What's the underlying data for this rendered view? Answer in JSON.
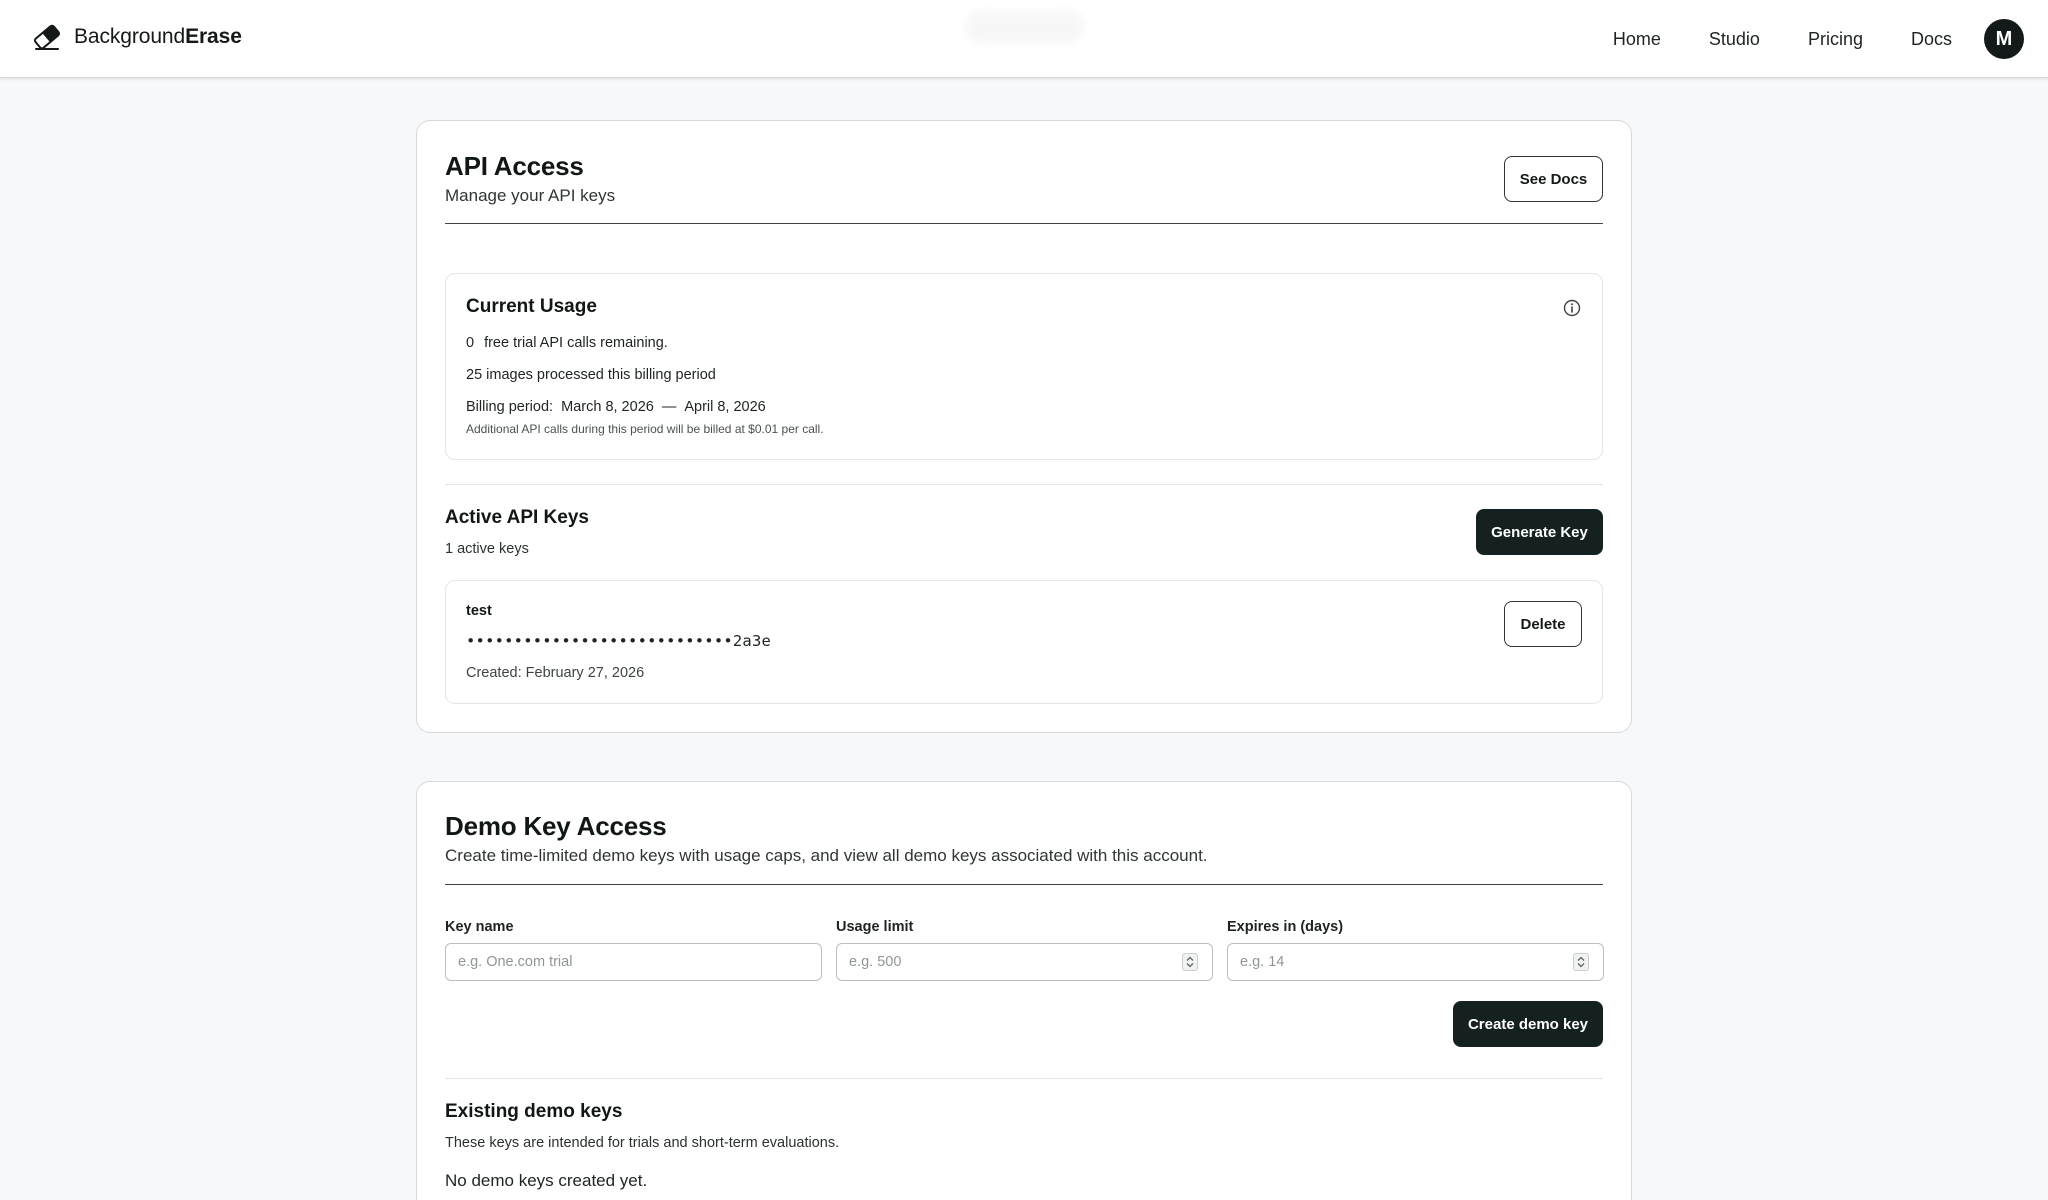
{
  "brand": {
    "name_part1": "Background",
    "name_part2": "Erase",
    "icon": "eraser-icon"
  },
  "nav": {
    "links": [
      "Home",
      "Studio",
      "Pricing",
      "Docs"
    ],
    "avatar_initial": "M"
  },
  "api_access": {
    "title": "API Access",
    "subtitle": "Manage your API keys",
    "docs_button": "See Docs",
    "usage": {
      "title": "Current Usage",
      "remaining_count": "0",
      "remaining_text": "free trial API calls remaining.",
      "processed_text": "25 images processed this billing period",
      "billing_label": "Billing period:",
      "billing_start": "March 8, 2026",
      "billing_separator": "—",
      "billing_end": "April 8, 2026",
      "note": "Additional API calls during this period will be billed at $0.01 per call.",
      "info_icon": "info-icon"
    },
    "keys": {
      "title": "Active API Keys",
      "count_text": "1 active keys",
      "generate_button": "Generate Key",
      "items": [
        {
          "name": "test",
          "masked_key": "••••••••••••••••••••••••••••2a3e",
          "created": "Created: February 27, 2026",
          "delete_button": "Delete"
        }
      ]
    }
  },
  "demo_access": {
    "title": "Demo Key Access",
    "subtitle": "Create time-limited demo keys with usage caps, and view all demo keys associated with this account.",
    "fields": {
      "key_name": {
        "label": "Key name",
        "placeholder": "e.g. One.com trial",
        "value": ""
      },
      "usage_limit": {
        "label": "Usage limit",
        "placeholder": "e.g. 500",
        "value": ""
      },
      "expires": {
        "label": "Expires in (days)",
        "placeholder": "e.g. 14",
        "value": ""
      }
    },
    "create_button": "Create demo key",
    "existing": {
      "title": "Existing demo keys",
      "subtitle": "These keys are intended for trials and short-term evaluations.",
      "empty_text": "No demo keys created yet."
    }
  },
  "colors": {
    "accent_dark": "#142120",
    "page_background": "#f7f8f9",
    "card_border": "#d6dada"
  }
}
